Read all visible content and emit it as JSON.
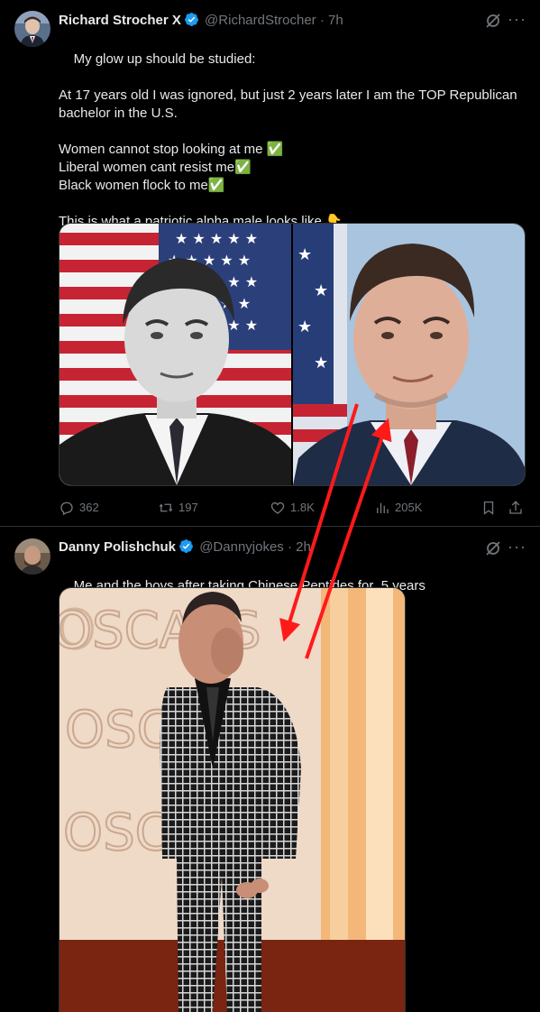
{
  "tweet1": {
    "display_name": "Richard Strocher X",
    "handle": "@RichardStrocher",
    "time": "· 7h",
    "text": "My glow up should be studied:\n\nAt 17 years old I was ignored, but just 2 years later I am the TOP Republican bachelor in the U.S.\n\nWomen cannot stop looking at me ✅\nLiberal women cant resist me✅\nBlack women flock to me✅\n\nThis is what a patriotic alpha male looks like 👇",
    "actions": {
      "replies": "362",
      "reposts": "197",
      "likes": "1.8K",
      "views": "205K"
    },
    "icons": {
      "reply": "reply-icon",
      "repost": "repost-icon",
      "like": "heart-icon",
      "views": "views-chart-icon",
      "bookmark": "bookmark-icon",
      "share": "share-icon",
      "grok": "grok-icon",
      "more": "more-icon"
    }
  },
  "tweet2": {
    "display_name": "Danny Polishchuk",
    "handle": "@Dannyjokes",
    "time": "· 2h",
    "text": "Me and the boys after taking Chinese Peptides for  5 years",
    "photo_sign_text": "OSCARS"
  },
  "colors": {
    "background": "#000000",
    "verified": "#1d9bf0",
    "secondary_text": "#71767b",
    "annotation_arrow": "#ff1a1a"
  }
}
